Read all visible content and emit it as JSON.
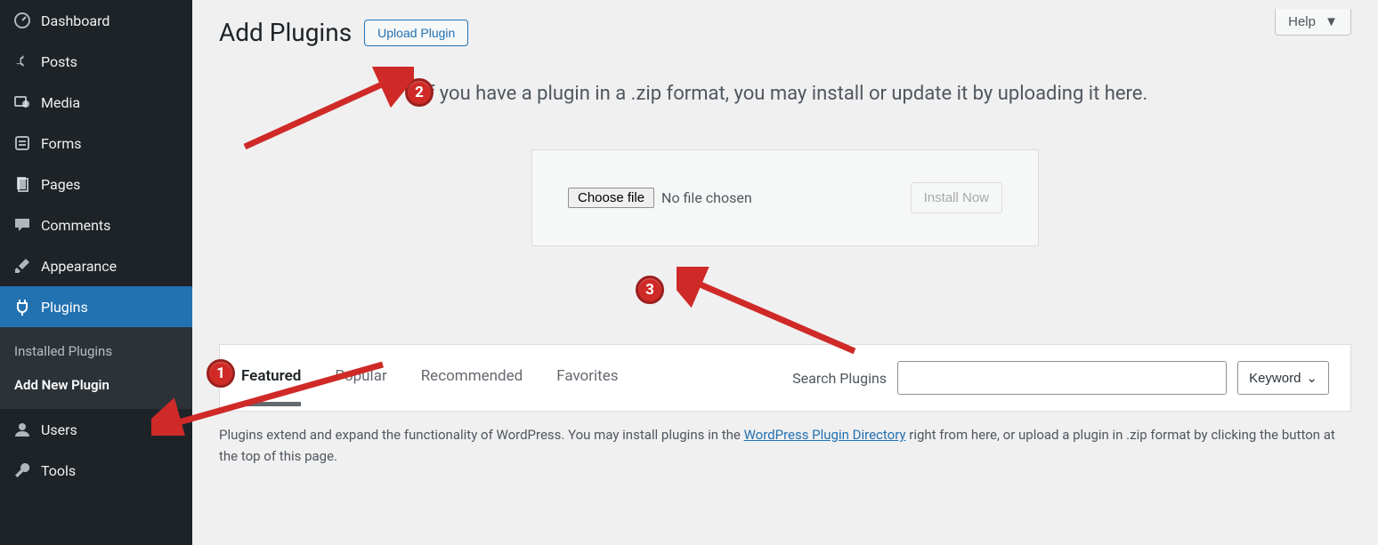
{
  "sidebar": {
    "items": [
      {
        "label": "Dashboard"
      },
      {
        "label": "Posts"
      },
      {
        "label": "Media"
      },
      {
        "label": "Forms"
      },
      {
        "label": "Pages"
      },
      {
        "label": "Comments"
      },
      {
        "label": "Appearance"
      },
      {
        "label": "Plugins"
      },
      {
        "label": "Users"
      },
      {
        "label": "Tools"
      }
    ],
    "submenu": {
      "installed": "Installed Plugins",
      "add_new": "Add New Plugin"
    }
  },
  "header": {
    "help": "Help",
    "title": "Add Plugins",
    "upload_button": "Upload Plugin"
  },
  "upload_panel": {
    "description": "If you have a plugin in a .zip format, you may install or update it by uploading it here.",
    "choose_file": "Choose file",
    "no_file": "No file chosen",
    "install_now": "Install Now"
  },
  "tabs": {
    "featured": "Featured",
    "popular": "Popular",
    "recommended": "Recommended",
    "favorites": "Favorites",
    "search_label": "Search Plugins",
    "keyword": "Keyword"
  },
  "footer": {
    "text_before": "Plugins extend and expand the functionality of WordPress. You may install plugins in the ",
    "link": "WordPress Plugin Directory",
    "text_after": " right from here, or upload a plugin in .zip format by clicking the button at the top of this page."
  },
  "annotations": {
    "b1": "1",
    "b2": "2",
    "b3": "3"
  }
}
